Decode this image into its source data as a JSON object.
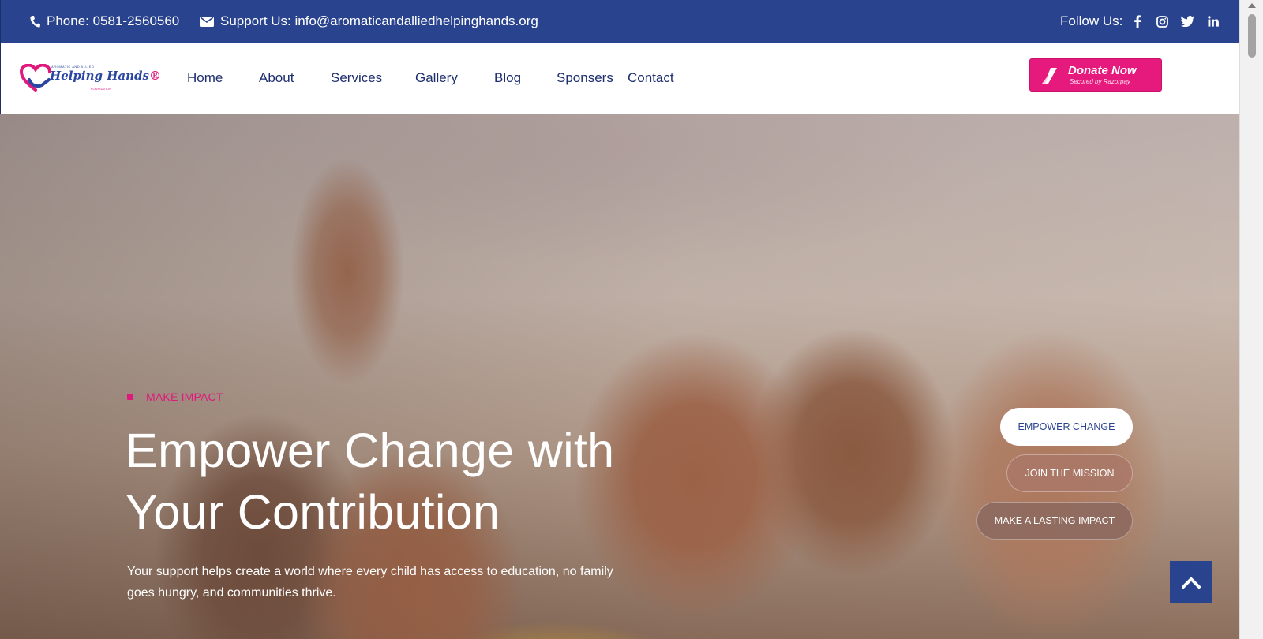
{
  "topbar": {
    "phone": "Phone: 0581-2560560",
    "support": "Support Us: info@aromaticandalliedhelpinghands.org",
    "follow_label": "Follow Us:",
    "social_icons": [
      "facebook-icon",
      "instagram-icon",
      "twitter-icon",
      "linkedin-icon"
    ],
    "background_color": "#29438e"
  },
  "logo": {
    "brand": "Helping Hands"
  },
  "nav": {
    "items": [
      "Home",
      "About",
      "Services",
      "Gallery",
      "Blog",
      "Sponsers",
      "Contact"
    ]
  },
  "donate": {
    "label": "Donate Now",
    "sublabel": "Secured by Razorpay",
    "color": "#e6197d"
  },
  "hero": {
    "eyebrow": "MAKE IMPACT",
    "title": "Empower Change with Your Contribution",
    "description": "Your support helps create a world where every child has access to education, no family goes hungry, and communities thrive.",
    "pills": [
      "EMPOWER CHANGE",
      "JOIN THE MISSION",
      "MAKE A LASTING IMPACT"
    ],
    "accent_color": "#e0197d"
  }
}
